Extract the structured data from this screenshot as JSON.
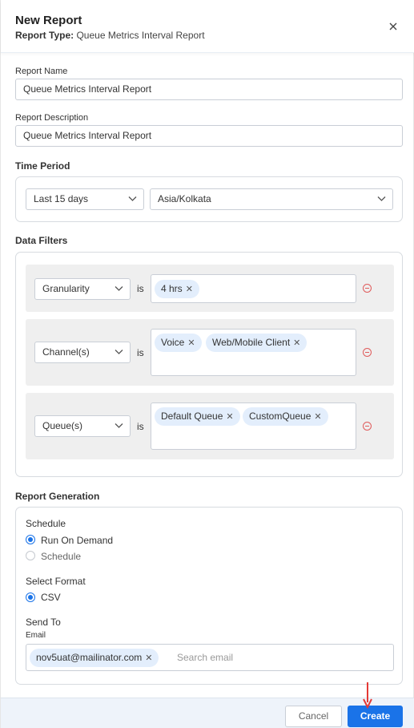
{
  "header": {
    "title": "New Report",
    "subtitle_label": "Report Type:",
    "subtitle_value": "Queue Metrics Interval Report"
  },
  "report_name": {
    "label": "Report Name",
    "value": "Queue Metrics Interval Report"
  },
  "report_description": {
    "label": "Report Description",
    "value": "Queue Metrics Interval Report"
  },
  "time_period": {
    "label": "Time Period",
    "range": "Last 15 days",
    "timezone": "Asia/Kolkata"
  },
  "data_filters": {
    "label": "Data Filters",
    "operator": "is",
    "rows": [
      {
        "field": "Granularity",
        "tags": [
          "4 hrs"
        ]
      },
      {
        "field": "Channel(s)",
        "tags": [
          "Voice",
          "Web/Mobile Client"
        ]
      },
      {
        "field": "Queue(s)",
        "tags": [
          "Default Queue",
          "CustomQueue"
        ]
      }
    ]
  },
  "report_generation": {
    "label": "Report Generation",
    "schedule_label": "Schedule",
    "schedule_options": [
      "Run On Demand",
      "Schedule"
    ],
    "schedule_selected": "Run On Demand",
    "format_label": "Select Format",
    "format_options": [
      "CSV"
    ],
    "format_selected": "CSV",
    "send_to_label": "Send To",
    "email_label": "Email",
    "email_tag": "nov5uat@mailinator.com",
    "email_placeholder": "Search email"
  },
  "footer": {
    "cancel_label": "Cancel",
    "create_label": "Create"
  },
  "colors": {
    "primary": "#1a73e8",
    "tag_bg": "#e3eefc",
    "remove": "#e05b5b",
    "arrow": "#e53935",
    "row_bg": "#efefef"
  }
}
